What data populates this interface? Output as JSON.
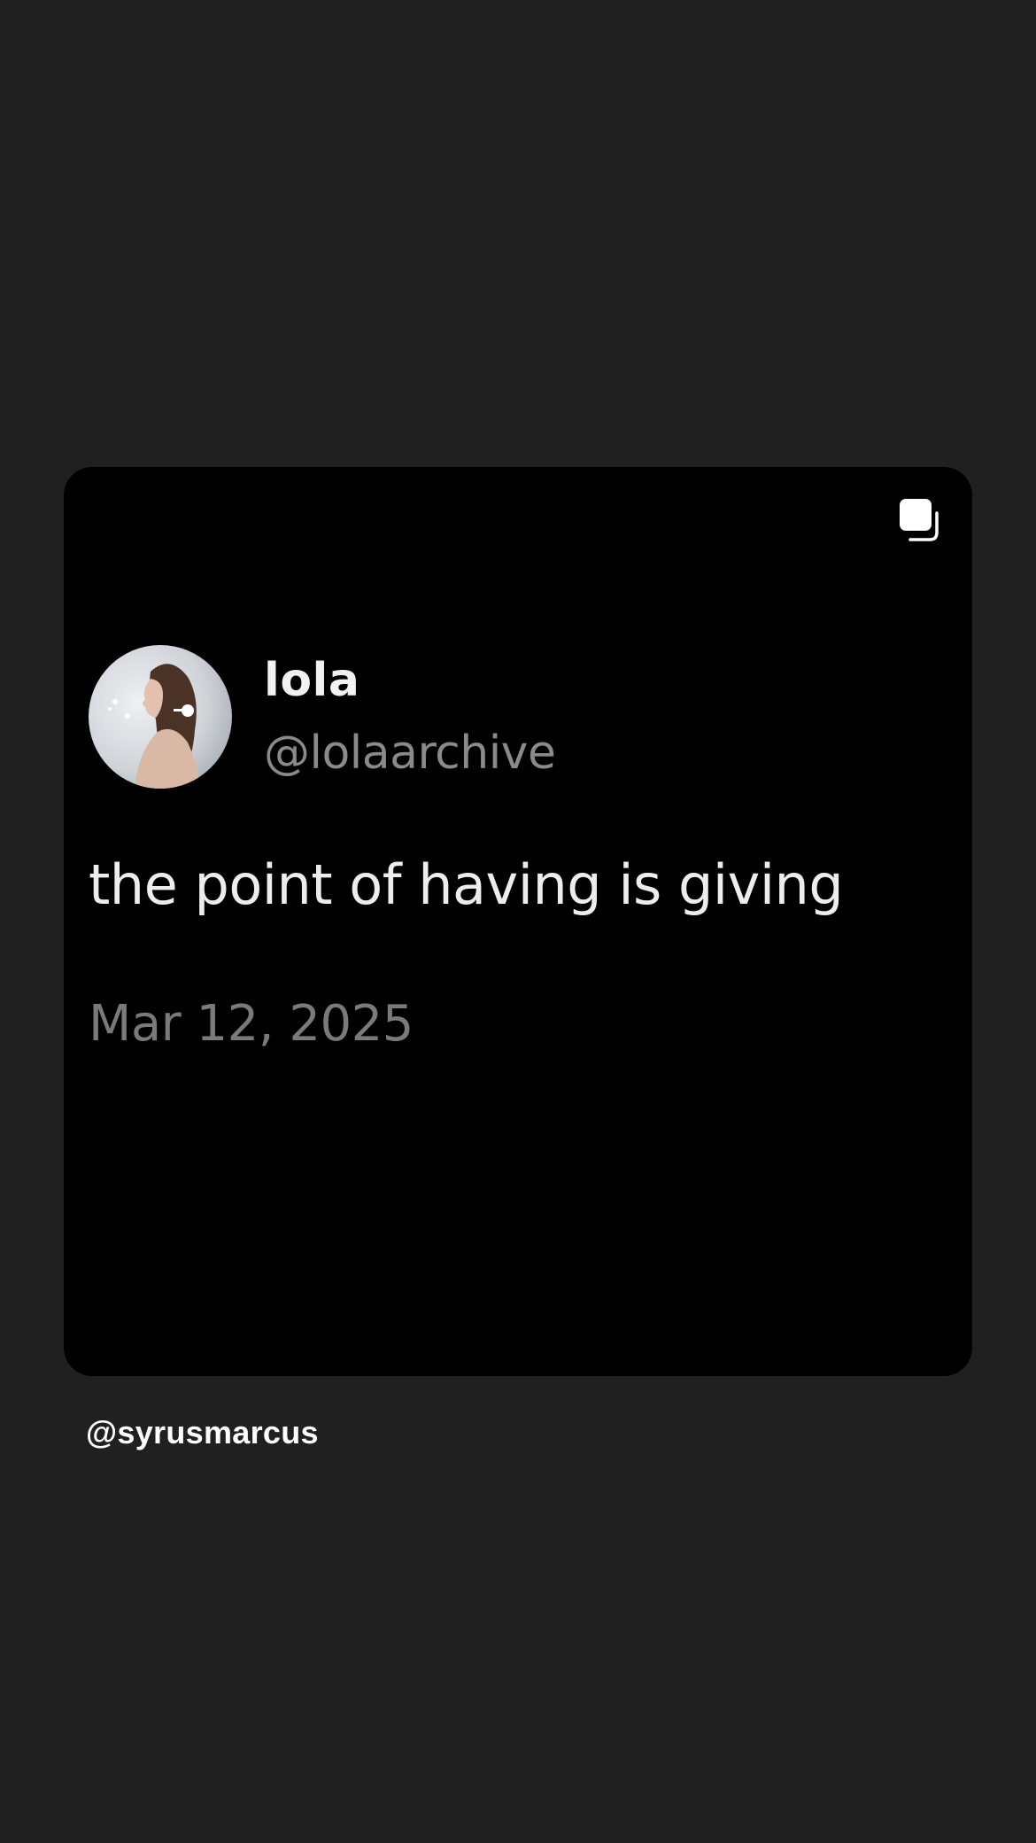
{
  "post": {
    "carousel_icon": "multiple-images-icon",
    "tweet": {
      "display_name": "lola",
      "handle": "@lolaarchive",
      "avatar_icon": "profile-photo",
      "text": "the point of having is giving",
      "date": "Mar 12, 2025"
    }
  },
  "caption": {
    "username": "@syrusmarcus"
  },
  "colors": {
    "background": "#202020",
    "card": "#000000",
    "primary_text": "#ededed",
    "secondary_text": "#8a8a8a"
  }
}
